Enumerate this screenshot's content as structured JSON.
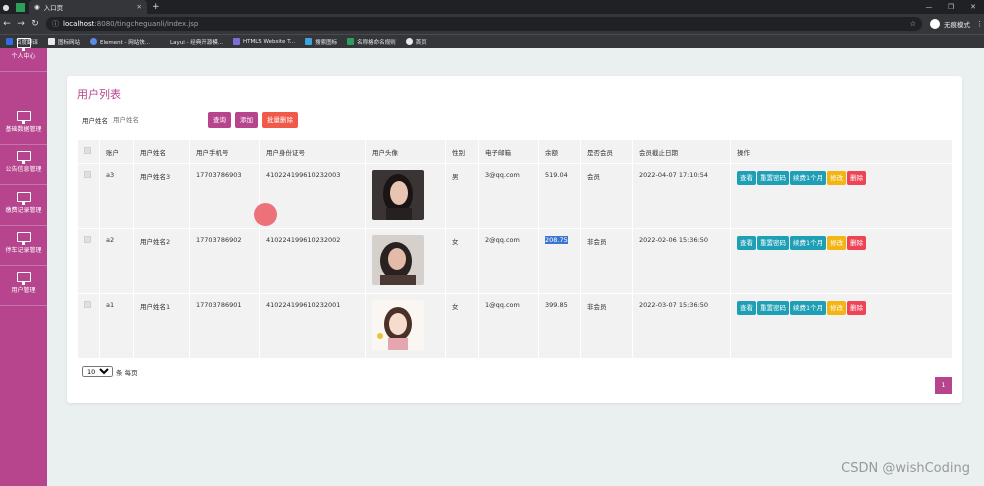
{
  "browser": {
    "tab_title": "入口页",
    "new_tab_glyph": "+",
    "url_host": "localhost",
    "url_path": ":8080/tingcheguanli/index.jsp",
    "profile_label": "无痕模式",
    "bookmarks": [
      "百度翻译",
      "图标网站",
      "Element - 网站快...",
      "Layui - 经典开源模...",
      "HTML5 Website T...",
      "搜索图标",
      "名称格命名规则",
      "首页"
    ],
    "bookmark_colors": [
      "#2f6de0",
      "#e8eaed",
      "#5b8de8",
      "#e8eaed",
      "#7a6fd8",
      "#3ea4e0",
      "#2ca05a",
      "#e8eaed"
    ]
  },
  "sidebar": {
    "items": [
      {
        "label": "个人中心",
        "icon": "monitor-icon"
      },
      {
        "label": "基础数据管理",
        "icon": "monitor-icon"
      },
      {
        "label": "公告信息管理",
        "icon": "monitor-icon"
      },
      {
        "label": "缴费记录管理",
        "icon": "monitor-icon"
      },
      {
        "label": "停车记录管理",
        "icon": "monitor-icon"
      },
      {
        "label": "用户管理",
        "icon": "monitor-icon"
      }
    ]
  },
  "page": {
    "title": "用户列表",
    "search_label": "用户姓名",
    "search_placeholder": "用户姓名",
    "btn_query": "查询",
    "btn_add": "添加",
    "btn_batch_delete": "批量删除"
  },
  "table": {
    "headers": [
      "",
      "账户",
      "用户姓名",
      "用户手机号",
      "用户身份证号",
      "用户头像",
      "性别",
      "电子邮箱",
      "余额",
      "是否会员",
      "会员截止日期",
      "操作"
    ],
    "rows": [
      {
        "account": "a3",
        "name": "用户姓名3",
        "phone": "17703786903",
        "id_card": "410224199610232003",
        "gender": "男",
        "email": "3@qq.com",
        "balance": "519.04",
        "member": "会员",
        "expire": "2022-04-07 17:10:54"
      },
      {
        "account": "a2",
        "name": "用户姓名2",
        "phone": "17703786902",
        "id_card": "410224199610232002",
        "gender": "女",
        "email": "2@qq.com",
        "balance": "208.75",
        "member": "非会员",
        "expire": "2022-02-06 15:36:50"
      },
      {
        "account": "a1",
        "name": "用户姓名1",
        "phone": "17703786901",
        "id_card": "410224199610232001",
        "gender": "女",
        "email": "1@qq.com",
        "balance": "399.85",
        "member": "非会员",
        "expire": "2022-03-07 15:36:50"
      }
    ],
    "ops": {
      "view": "查看",
      "reset": "重置密码",
      "renew": "续费1个月",
      "edit": "修改",
      "delete": "删除"
    }
  },
  "pager": {
    "page_size": "10",
    "per_page_suffix": "条 每页",
    "current_page": "1"
  },
  "watermark": "CSDN @wishCoding",
  "colors": {
    "accent": "#b6458e",
    "teal": "#1e9fb5",
    "warning": "#f2b514",
    "danger": "#ee4455",
    "delete_red": "#f05a4a"
  }
}
